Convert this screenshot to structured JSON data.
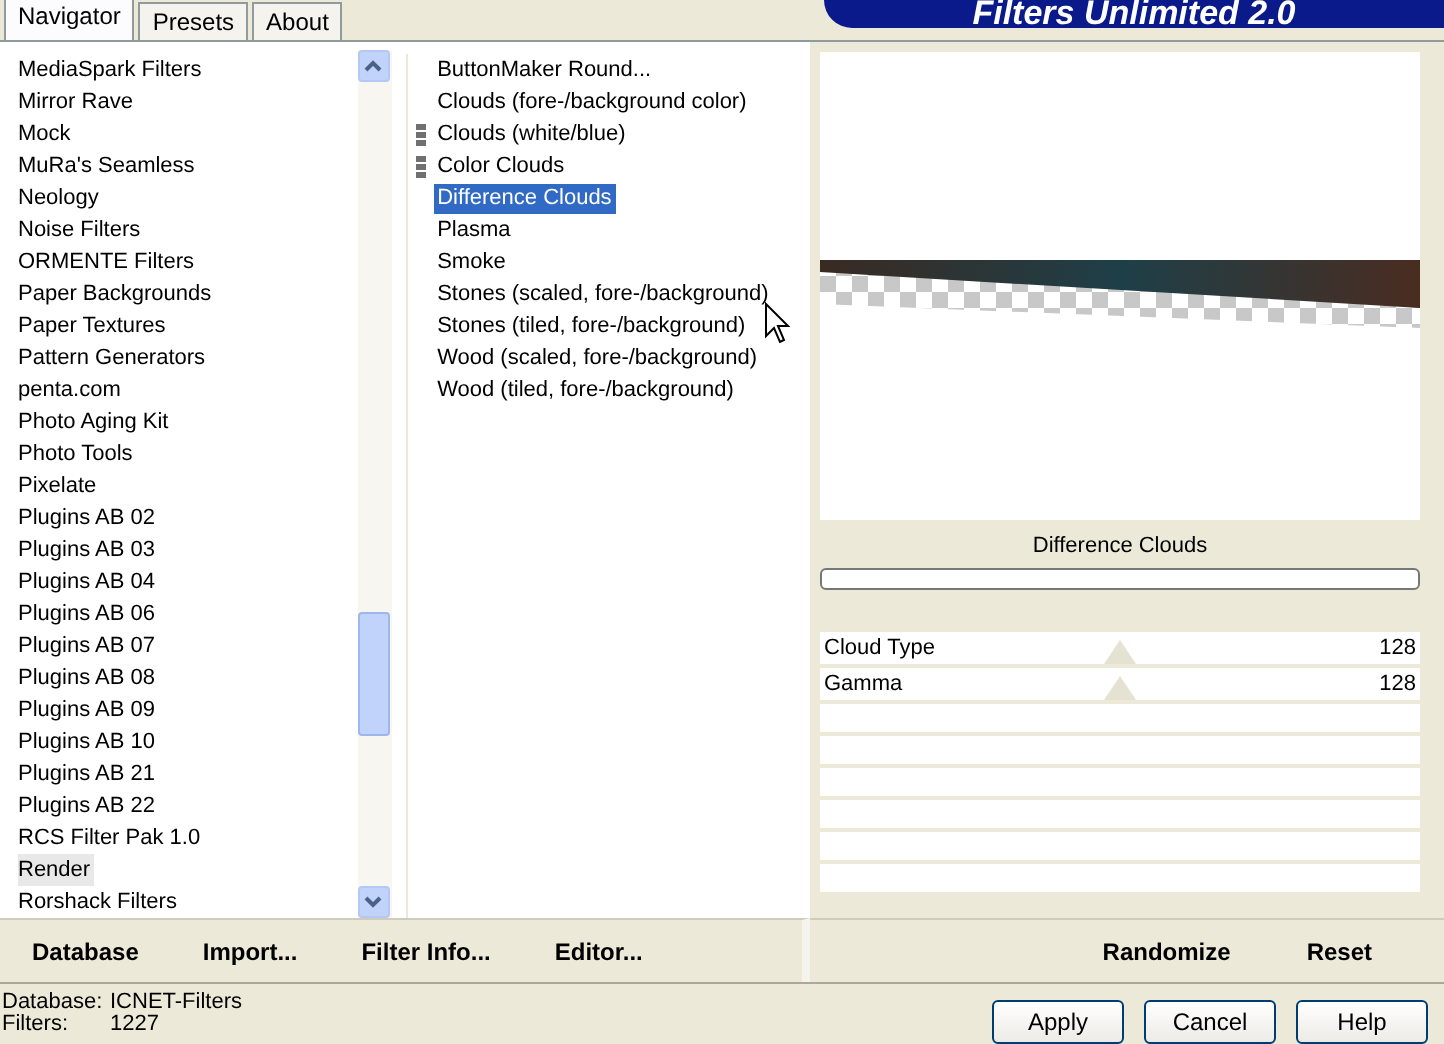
{
  "tabs": [
    {
      "label": "Navigator",
      "selected": true
    },
    {
      "label": "Presets",
      "selected": false
    },
    {
      "label": "About",
      "selected": false
    }
  ],
  "banner": {
    "title": "Filters Unlimited 2.0"
  },
  "categories": [
    {
      "label": "MediaSpark Filters",
      "selected": false
    },
    {
      "label": "Mirror Rave",
      "selected": false
    },
    {
      "label": "Mock",
      "selected": false
    },
    {
      "label": "MuRa's Seamless",
      "selected": false
    },
    {
      "label": "Neology",
      "selected": false
    },
    {
      "label": "Noise Filters",
      "selected": false
    },
    {
      "label": "ORMENTE Filters",
      "selected": false
    },
    {
      "label": "Paper Backgrounds",
      "selected": false
    },
    {
      "label": "Paper Textures",
      "selected": false
    },
    {
      "label": "Pattern Generators",
      "selected": false
    },
    {
      "label": "penta.com",
      "selected": false
    },
    {
      "label": "Photo Aging Kit",
      "selected": false
    },
    {
      "label": "Photo Tools",
      "selected": false
    },
    {
      "label": "Pixelate",
      "selected": false
    },
    {
      "label": "Plugins AB 02",
      "selected": false
    },
    {
      "label": "Plugins AB 03",
      "selected": false
    },
    {
      "label": "Plugins AB 04",
      "selected": false
    },
    {
      "label": "Plugins AB 06",
      "selected": false
    },
    {
      "label": "Plugins AB 07",
      "selected": false
    },
    {
      "label": "Plugins AB 08",
      "selected": false
    },
    {
      "label": "Plugins AB 09",
      "selected": false
    },
    {
      "label": "Plugins AB 10",
      "selected": false
    },
    {
      "label": "Plugins AB 21",
      "selected": false
    },
    {
      "label": "Plugins AB 22",
      "selected": false
    },
    {
      "label": "RCS Filter Pak 1.0",
      "selected": false
    },
    {
      "label": "Render",
      "selected": true
    },
    {
      "label": "Rorshack Filters",
      "selected": false
    }
  ],
  "filters": [
    {
      "label": "ButtonMaker Round...",
      "selected": false,
      "marked": false
    },
    {
      "label": "Clouds (fore-/background color)",
      "selected": false,
      "marked": false
    },
    {
      "label": "Clouds (white/blue)",
      "selected": false,
      "marked": true
    },
    {
      "label": "Color Clouds",
      "selected": false,
      "marked": true
    },
    {
      "label": "Difference Clouds",
      "selected": true,
      "marked": false
    },
    {
      "label": "Plasma",
      "selected": false,
      "marked": false
    },
    {
      "label": "Smoke",
      "selected": false,
      "marked": false
    },
    {
      "label": "Stones (scaled, fore-/background)",
      "selected": false,
      "marked": false
    },
    {
      "label": "Stones (tiled, fore-/background)",
      "selected": false,
      "marked": false
    },
    {
      "label": "Wood (scaled, fore-/background)",
      "selected": false,
      "marked": false
    },
    {
      "label": "Wood (tiled, fore-/background)",
      "selected": false,
      "marked": false
    }
  ],
  "filter_title": "Difference Clouds",
  "controls": [
    {
      "name": "Cloud Type",
      "level": 0.5,
      "reading": "128"
    },
    {
      "name": "Gamma",
      "level": 0.5,
      "reading": "128"
    }
  ],
  "progress": {
    "level": 0
  },
  "left_buttons": [
    "Database",
    "Import...",
    "Filter Info...",
    "Editor..."
  ],
  "right_buttons": [
    "Randomize",
    "Reset"
  ],
  "status": [
    {
      "label": "Database:",
      "value": "ICNET-Filters"
    },
    {
      "label": "Filters:",
      "value": "1227"
    }
  ],
  "dialog_buttons": [
    "Apply",
    "Cancel",
    "Help"
  ]
}
